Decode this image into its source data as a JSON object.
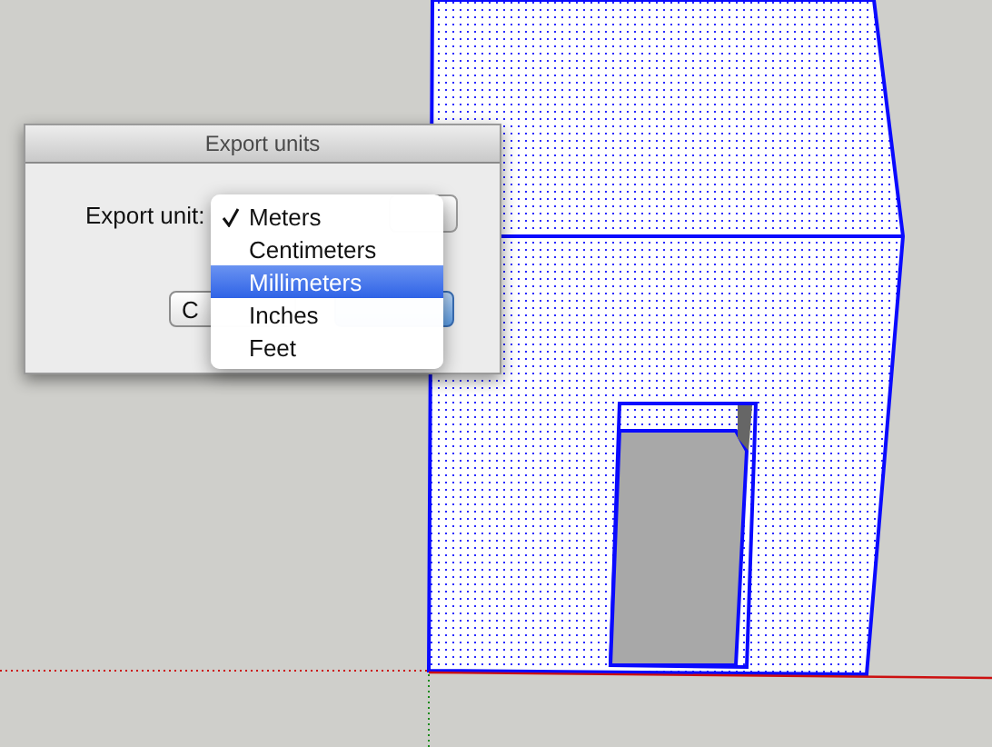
{
  "dialog": {
    "title": "Export units",
    "field_label": "Export unit:",
    "buttons": [
      {
        "label": "C",
        "default": false
      },
      {
        "default": true
      }
    ]
  },
  "menu": {
    "items": [
      {
        "label": "Meters",
        "checked": true,
        "selected": false
      },
      {
        "label": "Centimeters",
        "checked": false,
        "selected": false
      },
      {
        "label": "Millimeters",
        "checked": false,
        "selected": true
      },
      {
        "label": "Inches",
        "checked": false,
        "selected": false
      },
      {
        "label": "Feet",
        "checked": false,
        "selected": false
      }
    ]
  }
}
